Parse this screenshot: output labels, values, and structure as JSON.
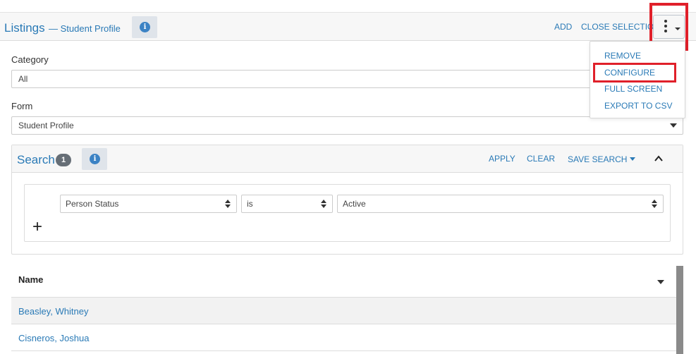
{
  "header": {
    "title": "Listings",
    "subtitle": "— Student Profile",
    "info_icon": "info-icon",
    "add_label": "ADD",
    "close_selection_label": "CLOSE SELECTION",
    "more_menu_icon": "vertical-ellipsis-icon"
  },
  "more_menu": {
    "items": [
      "REMOVE",
      "CONFIGURE",
      "FULL SCREEN",
      "EXPORT TO CSV"
    ],
    "highlighted_item": "CONFIGURE"
  },
  "filters": {
    "category_label": "Category",
    "category_value": "All",
    "form_label": "Form",
    "form_value": "Student Profile"
  },
  "search": {
    "title": "Search",
    "count": "1",
    "apply_label": "APPLY",
    "clear_label": "CLEAR",
    "save_search_label": "SAVE SEARCH",
    "criteria": {
      "field": "Person Status",
      "operator": "is",
      "value": "Active"
    },
    "add_criteria_icon": "plus-icon"
  },
  "list": {
    "column_header": "Name",
    "rows": [
      "Beasley, Whitney",
      "Cisneros, Joshua"
    ]
  },
  "colors": {
    "link": "#2a7ab6",
    "highlight": "#e0202a",
    "header_bg": "#f7f7f7"
  }
}
